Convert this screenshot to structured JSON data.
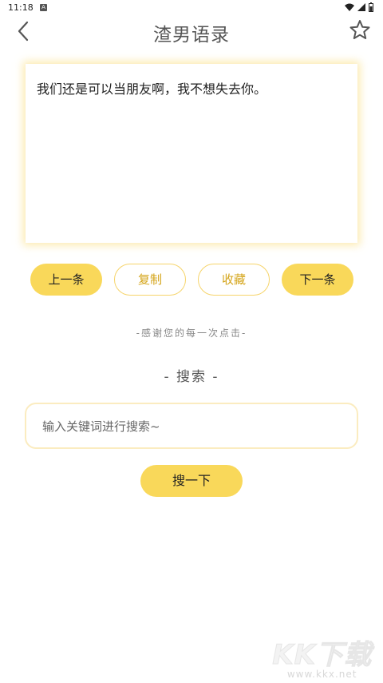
{
  "status": {
    "time": "11:18",
    "notification": "A"
  },
  "header": {
    "title": "渣男语录"
  },
  "quote": {
    "text": "我们还是可以当朋友啊，我不想失去你。"
  },
  "actions": {
    "prev": "上一条",
    "copy": "复制",
    "favorite": "收藏",
    "next": "下一条"
  },
  "thanks": "-感谢您的每一次点击-",
  "search": {
    "title": "- 搜索 -",
    "placeholder": "输入关键词进行搜索~",
    "button": "搜一下"
  },
  "watermark": {
    "logo": "KK下载",
    "url": "www.kkx.net"
  },
  "colors": {
    "accent": "#f9d85a",
    "accent_text": "#d4a418"
  }
}
